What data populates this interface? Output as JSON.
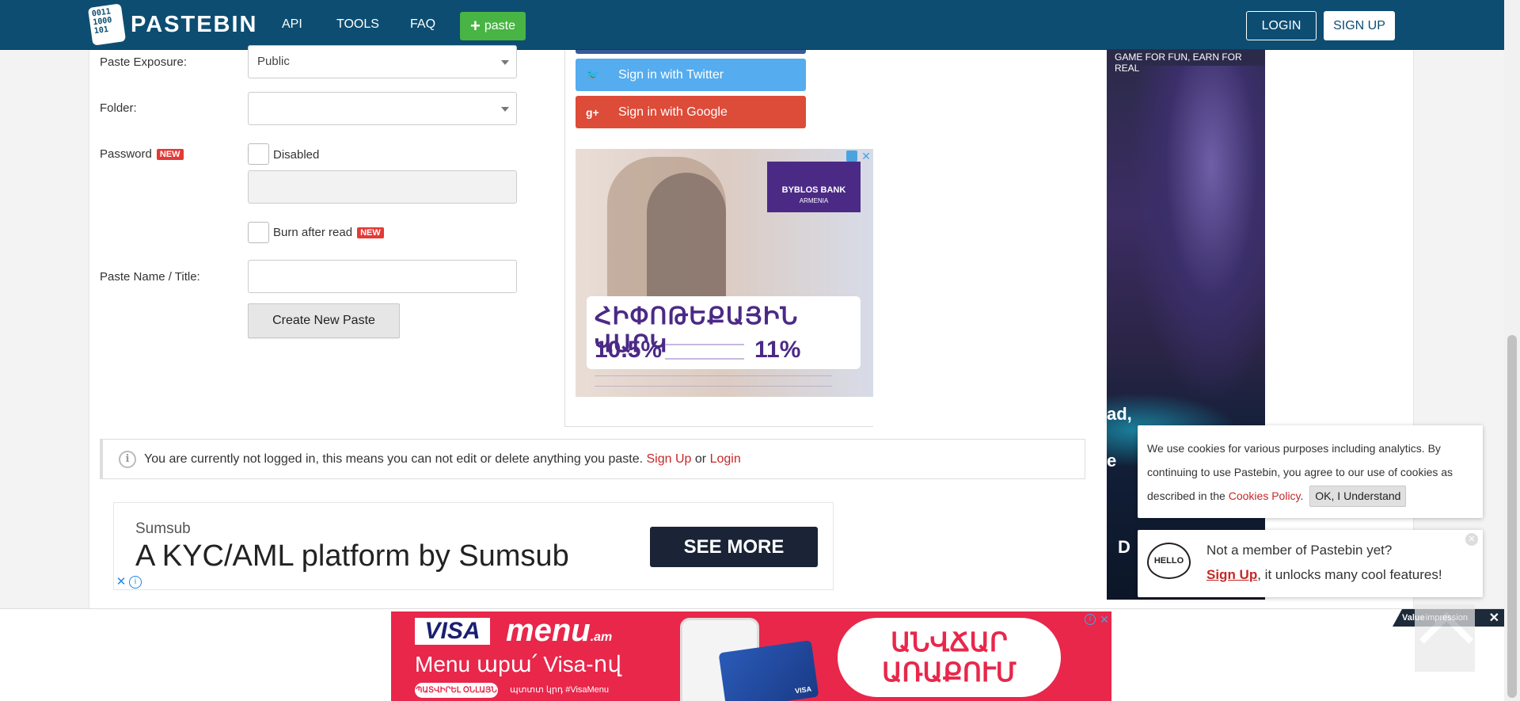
{
  "header": {
    "logo_text": "PASTEBIN",
    "logo_bits": "0011\n1000\n101",
    "nav": [
      "API",
      "TOOLS",
      "FAQ"
    ],
    "paste_button": "paste",
    "login": "LOGIN",
    "signup": "SIGN UP"
  },
  "form": {
    "exposure_label": "Paste Exposure:",
    "exposure_value": "Public",
    "folder_label": "Folder:",
    "folder_value": "",
    "password_label": "Password",
    "password_badge": "NEW",
    "password_disabled_label": "Disabled",
    "burn_label": "Burn after read",
    "burn_badge": "NEW",
    "title_label": "Paste Name / Title:",
    "title_value": "",
    "create_button": "Create New Paste"
  },
  "signin": {
    "twitter": "Sign in with Twitter",
    "google": "Sign in with Google"
  },
  "bank_ad": {
    "brand": "BYBLOS BANK",
    "brand_sub": "ARMENIA",
    "headline": "ՀԻՓՈԹԵՔԱՅԻՆ ՎԱՐԿ",
    "rate1": "10.5%",
    "rate2": "11%"
  },
  "notice": {
    "text": "You are currently not logged in, this means you can not edit or delete anything you paste.",
    "signup_link": "Sign Up",
    "or": "or",
    "login_link": "Login"
  },
  "sumsub_ad": {
    "brand": "Sumsub",
    "title": "A KYC/AML platform by Sumsub",
    "button": "SEE MORE"
  },
  "sky_ad": {
    "tagline": "GAME FOR FUN, EARN FOR REAL",
    "fragment1": "ad,",
    "fragment2": "e",
    "fragment3": "D"
  },
  "cookie": {
    "text": "We use cookies for various purposes including analytics. By continuing to use Pastebin, you agree to our use of cookies as described in the",
    "link": "Cookies Policy",
    "period": ".",
    "button": "OK, I Understand"
  },
  "member_popup": {
    "icon_text": "HELLO",
    "line1": "Not a member of Pastebin yet?",
    "signup_link": "Sign Up",
    "line2_rest": ", it unlocks many cool features!"
  },
  "bottom_ad": {
    "visa": "VISA",
    "menu": "menu",
    "menu_suffix": ".am",
    "tagline": "Menu աpա՛ Visa-ով",
    "pill": "ՊԱՏՎԻՐԵԼ ՕՆԼԱՅՆ",
    "hashtag": "պտտտ կրդ #VisaMenu",
    "card_label": "VISA",
    "bubble": "ԱՆՎՃԱՐ ԱՌԱՔՈՒՄ"
  },
  "vi_tag": {
    "brand_bold": "Value",
    "brand_rest": "impression"
  },
  "colors": {
    "header_bg": "#0d4d72",
    "paste_green": "#48b444",
    "twitter": "#55acee",
    "google": "#dd4b39",
    "link_red": "#c62828",
    "badge_red": "#e53935"
  }
}
